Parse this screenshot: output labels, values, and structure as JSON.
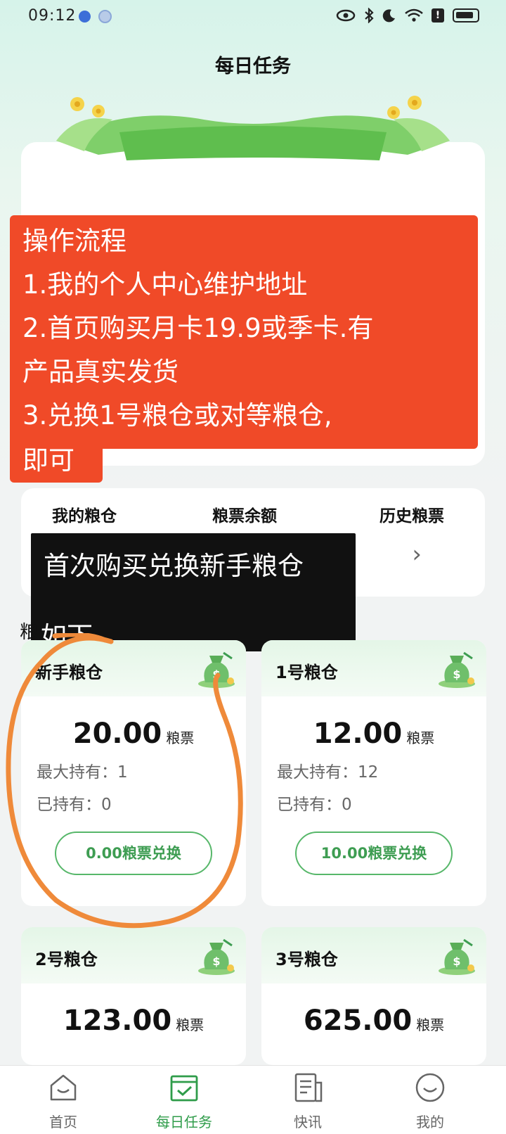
{
  "status_bar": {
    "time": "09:12"
  },
  "header": {
    "title": "每日任务"
  },
  "process_note": {
    "lines": [
      "操作流程",
      "1.我的个人中心维护地址",
      "2.首页购买月卡19.9或季卡.有",
      "产品真实发货",
      "3.兑换1号粮仓或对等粮仓,",
      "即可"
    ]
  },
  "stats": {
    "labels": [
      "我的粮仓",
      "粮票余额",
      "历史粮票"
    ]
  },
  "caption": {
    "line1": "首次购买兑换新手粮仓",
    "line2": "如下",
    "stray": "粮"
  },
  "granaries": [
    {
      "title": "新手粮仓",
      "price": "20.00",
      "unit": "粮票",
      "max_label": "最大持有：1",
      "held_label": "已持有：0",
      "button": "0.00粮票兑换"
    },
    {
      "title": "1号粮仓",
      "price": "12.00",
      "unit": "粮票",
      "max_label": "最大持有：12",
      "held_label": "已持有：0",
      "button": "10.00粮票兑换"
    },
    {
      "title": "2号粮仓",
      "price": "123.00",
      "unit": "粮票"
    },
    {
      "title": "3号粮仓",
      "price": "625.00",
      "unit": "粮票"
    }
  ],
  "bottom_nav": {
    "items": [
      {
        "label": "首页",
        "icon": "home-icon"
      },
      {
        "label": "每日任务",
        "icon": "task-check-icon",
        "active": true
      },
      {
        "label": "快讯",
        "icon": "news-icon"
      },
      {
        "label": "我的",
        "icon": "profile-icon"
      }
    ]
  },
  "colors": {
    "accent": "#2f9c4a",
    "note_bg": "#f04a28",
    "caption_bg": "#111111",
    "circle": "#ef8a3a"
  }
}
